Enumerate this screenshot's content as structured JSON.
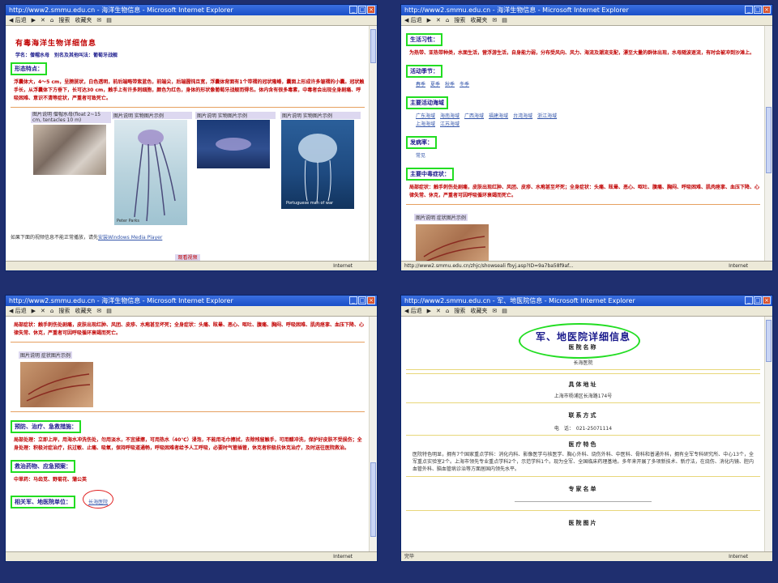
{
  "windows": [
    {
      "title": "http://www2.smmu.edu.cn - 海洋生物信息 - Microsoft Internet Explorer",
      "toolbar": [
        "◀ 后退",
        "▶",
        "✕",
        "⌂",
        "搜索",
        "收藏夹",
        "✉",
        "▤"
      ],
      "status": "",
      "zone": "Internet"
    },
    {
      "title": "http://www2.smmu.edu.cn - 海洋生物信息 - Microsoft Internet Explorer",
      "toolbar": [
        "◀ 后退",
        "▶",
        "✕",
        "⌂",
        "搜索",
        "收藏夹",
        "✉",
        "▤"
      ],
      "status": "http://www2.smmu.edu.cn/zhjc/showseali fbyj.asp?ID=9a7ba58f9af...",
      "zone": "Internet"
    },
    {
      "title": "http://www2.smmu.edu.cn - 海洋生物信息 - Microsoft Internet Explorer",
      "toolbar": [
        "◀ 后退",
        "▶",
        "✕",
        "⌂",
        "搜索",
        "收藏夹",
        "✉",
        "▤"
      ],
      "status": "",
      "zone": "Internet"
    },
    {
      "title": "http://www2.smmu.edu.cn - 军、地医院信息 - Microsoft Internet Explorer",
      "toolbar": [
        "◀ 后退",
        "▶",
        "✕",
        "⌂",
        "搜索",
        "收藏夹",
        "✉",
        "▤"
      ],
      "status": "完毕",
      "zone": "Internet"
    }
  ],
  "p1": {
    "title": "有毒海洋生物详细信息",
    "names": "学名：僧帽水母　别名及其他叫法：葡萄牙战舰",
    "morph_label": "形态特点：",
    "morph_text": "浮囊体大，4～5 cm，呈膀胱状，白色透明，前后端略带紫蓝色，前端尖，后端圆钝且宽，浮囊体背面有1个带褶的冠状隆嵴，囊面上形成许多皱褶的小囊。冠状触手长，从浮囊体下方垂下，长可达30 cm，触手上有许多刺细胞，颜色为红色，身体的形状像葡萄牙战舰而得名。体内含有很多毒素，中毒者会出现全身剧痛、呼吸困难、意识不清等症状，严重者可致死亡。",
    "captions": [
      "图片说明 僧帽水母(float 2~15 cm, tentacles 10 m)",
      "图片说明 实物图片示例",
      "图片说明 实物图片示例",
      "图片说明 实物图片示例"
    ],
    "photo_label_2": "Portuguese man of war",
    "photo_label_1": "Peter Parks",
    "player_note": "如果下面的视频信息不能正常播放，请先",
    "player_link": "安装Windows Media Player",
    "video_btn": "观看视频"
  },
  "p2": {
    "habit_label": "生活习性：",
    "habit_text": "为热带、亚热带种类，水面生活，营浮游生活，自身能力弱，分布受风向、风力、海流及潮流支配，漂至大量的群体出现，水母随波逐流，有时会被冲到沙滩上。",
    "season_label": "活动季节：",
    "seasons": [
      "春季",
      "夏季",
      "秋季",
      "冬季"
    ],
    "area_label": "主要活动海域",
    "areas": [
      "广东海域",
      "海南海域",
      "广西海域",
      "福建海域",
      "台湾海域",
      "浙江海域",
      "上海海域",
      "江苏海域"
    ],
    "rate_label": "发病率：",
    "rate": "常见",
    "symptom_label": "主要中毒症状：",
    "symptom_text": "局部症状：触手刺伤处剧痛，皮肤出现红肿、风团、皮疹、水疱甚至坏死；全身症状：头痛、眩晕、恶心、呕吐、腹痛、胸闷、呼吸困难、肌肉痉挛、血压下降、心律失常、休克，严重者可因呼吸循环衰竭而死亡。",
    "caption": "图片说明 症状图片示例"
  },
  "p3": {
    "symptom_text": "局部症状：触手刺伤处剧痛，皮肤出现红肿、风团、皮疹、水疱甚至坏死；全身症状：头痛、眩晕、恶心、呕吐、腹痛、胸闷、呼吸困难、肌肉痉挛、血压下降、心律失常、休克，严重者可因呼吸循环衰竭而死亡。",
    "caption": "图片说明 症状图片示例",
    "prevent_label": "预防、治疗、急救措施：",
    "prevent_text": "局部处理：立即上岸，用海水冲洗伤处，勿用淡水，不宜揉擦，可用热水（40℃）浸泡，不能用毛巾擦拭，去除残留触手，可用醋冲洗，保护好皮肤不受损伤；全身处理：积极对症治疗，抗过敏、止痛、吸氧，保持呼吸道通畅，呼吸困难者给予人工呼吸，必要时气管插管，休克者积极抗休克治疗，及时送往医院救治。",
    "drug_label": "救治药物、应急预案：",
    "drugs": "中草药：马齿苋、野菊花、蒲公英",
    "hosp_label": "相关军、地医院单位：",
    "hosp_link": "长海医院"
  },
  "p4": {
    "title": "军、地医院详细信息",
    "name_label": "医院名称",
    "name": "长海医院",
    "addr_label": "具体地址",
    "addr": "上海市杨浦区长海路174号",
    "contact_label": "联系方式",
    "phone": "电　话：　021-25071114",
    "feature_label": "医疗特色",
    "feature_text": "医院特色明显，拥有7个国家重点学科：消化内科、影像医学与核医学、胸心外科、烧伤外科、中医科、骨科和普通外科，拥有全军专科研究所、中心13个，全军重点实验室2个。上海市领先专业重点学科2个，示范学科1个。现为全军、全国临床药理基地。多年来开展了多项新技术、新疗法，在烧伤、消化内镜、腔内血管外科、脑血管病诊治等方面居国内领先水平。",
    "expert_label": "专家名单",
    "photo_label": "医院图片"
  }
}
